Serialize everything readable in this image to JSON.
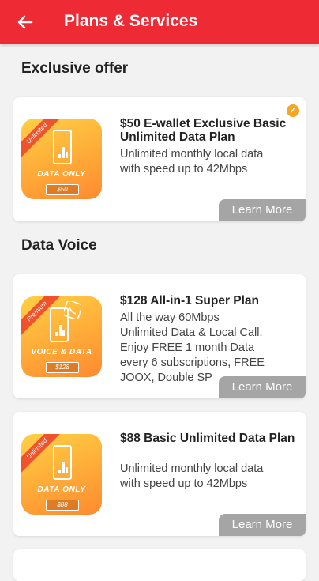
{
  "header": {
    "title": "Plans & Services",
    "back_icon": "arrow-left-icon"
  },
  "sections": [
    {
      "title": "Exclusive offer"
    },
    {
      "title": "Data Voice"
    }
  ],
  "plans": [
    {
      "thumb_ribbon": "Unlimited",
      "thumb_label": "DATA ONLY",
      "thumb_price": "$50",
      "title": "$50 E-wallet Exclusive Basic Unlimited Data Plan",
      "desc_lines": [
        "Unlimited monthly local data",
        "with speed up to 42Mbps"
      ],
      "learn_more": "Learn More",
      "selected": true
    },
    {
      "thumb_ribbon": "Premium",
      "thumb_label": "VOICE & DATA",
      "thumb_price": "$128",
      "title": "$128 All-in-1 Super Plan",
      "desc_lines": [
        "All the way 60Mbps",
        "Unlimited Data & Local Call.",
        "Enjoy FREE 1 month Data",
        "every 6 subscriptions, FREE",
        "JOOX, Double SP"
      ],
      "learn_more": "Learn More",
      "selected": false
    },
    {
      "thumb_ribbon": "Unlimited",
      "thumb_label": "DATA ONLY",
      "thumb_price": "$88",
      "title": "$88 Basic Unlimited Data Plan",
      "desc_lines": [
        "Unlimited monthly local data",
        "with speed up to 42Mbps"
      ],
      "learn_more": "Learn More",
      "selected": false
    }
  ],
  "colors": {
    "header_bg": "#ee2a34",
    "learn_more_bg": "#a5a5a5",
    "check_badge": "#f5a623",
    "ribbon": "#f0522c"
  }
}
